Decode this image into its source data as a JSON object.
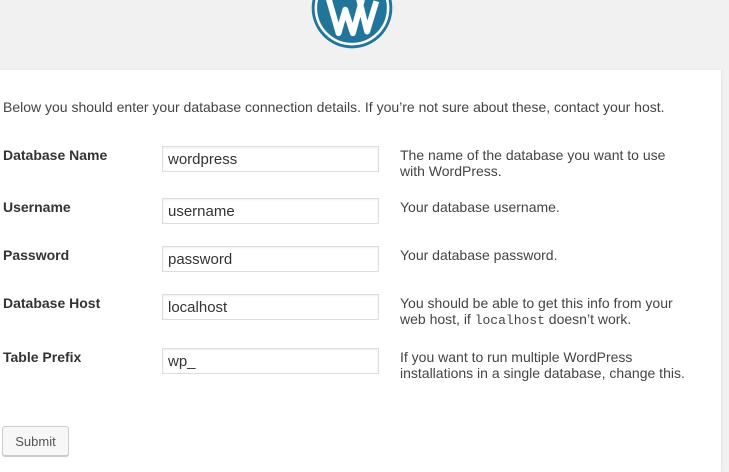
{
  "header": {
    "logo_icon": "wordpress-logo-icon",
    "brand_color": "#21759b"
  },
  "intro": "Below you should enter your database connection details. If you’re not sure about these, contact your host.",
  "fields": [
    {
      "label": "Database Name",
      "value": "wordpress",
      "help": "The name of the database you want to use with WordPress."
    },
    {
      "label": "Username",
      "value": "username",
      "help": "Your database username."
    },
    {
      "label": "Password",
      "value": "password",
      "help": "Your database password."
    },
    {
      "label": "Database Host",
      "value": "localhost",
      "help_before": "You should be able to get this info from your web host, if ",
      "help_code": "localhost",
      "help_after": " doesn’t work."
    },
    {
      "label": "Table Prefix",
      "value": "wp_",
      "help": "If you want to run multiple WordPress installations in a single database, change this."
    }
  ],
  "submit_label": "Submit"
}
